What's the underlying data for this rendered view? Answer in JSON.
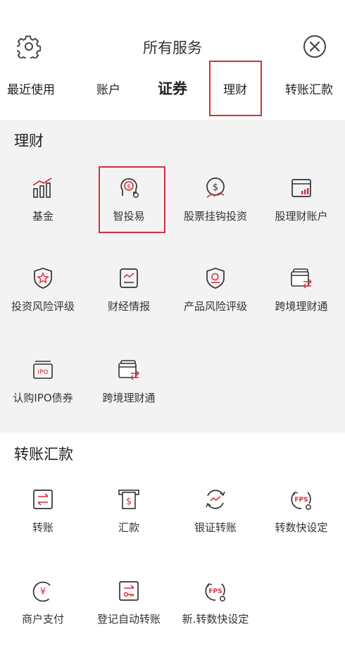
{
  "header": {
    "title": "所有服务"
  },
  "tabs": [
    {
      "label": "最近使用"
    },
    {
      "label": "账户"
    },
    {
      "label": "证券"
    },
    {
      "label": "理财"
    },
    {
      "label": "转账汇款"
    }
  ],
  "sections": [
    {
      "title": "理财",
      "items": [
        {
          "label": "基金",
          "icon": "chart-bars-icon"
        },
        {
          "label": "智投易",
          "icon": "robo-advisor-icon"
        },
        {
          "label": "股票挂钩投资",
          "icon": "dollar-trend-icon"
        },
        {
          "label": "股理财账户",
          "icon": "account-chart-icon"
        },
        {
          "label": "投资风险评级",
          "icon": "shield-star-icon"
        },
        {
          "label": "财经情报",
          "icon": "news-chart-icon"
        },
        {
          "label": "产品风险评级",
          "icon": "shield-search-icon"
        },
        {
          "label": "跨境理财通",
          "icon": "cross-border-icon"
        },
        {
          "label": "认购IPO债券",
          "icon": "ipo-icon"
        },
        {
          "label": "跨境理财通",
          "icon": "cross-border-icon"
        }
      ]
    },
    {
      "title": "转账汇款",
      "items": [
        {
          "label": "转账",
          "icon": "transfer-icon"
        },
        {
          "label": "汇款",
          "icon": "remittance-icon"
        },
        {
          "label": "银证转账",
          "icon": "bank-securities-icon"
        },
        {
          "label": "转数快设定",
          "icon": "fps-settings-icon"
        },
        {
          "label": "商户支付",
          "icon": "merchant-pay-icon"
        },
        {
          "label": "登记自动转账",
          "icon": "auto-transfer-icon"
        },
        {
          "label": "新.转数快设定",
          "icon": "fps-new-icon"
        }
      ]
    }
  ],
  "colors": {
    "accent": "#d2303d",
    "highlight_border": "#d2303d",
    "section_bg": "#f3f3f3"
  }
}
